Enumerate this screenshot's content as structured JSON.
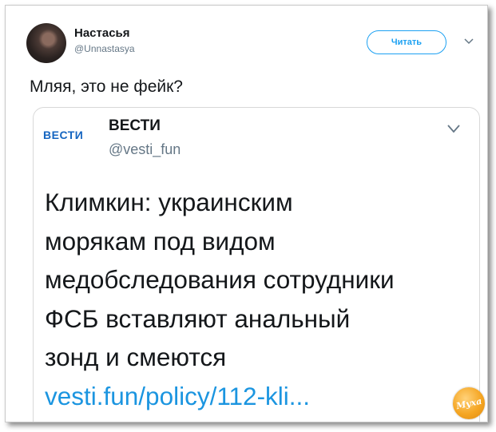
{
  "tweet": {
    "author_name": "Настасья",
    "author_handle": "@Unnastasya",
    "follow_label": "Читать",
    "text": "Мляя, это не фейк?"
  },
  "quoted_tweet": {
    "logo_text": "ВЕСТИ",
    "name": "ВЕСТИ",
    "handle": "@vesti_fun",
    "text_lines": [
      "Климкин: украинским",
      "морякам под видом",
      "медобследования сотрудники",
      "ФСБ вставляют анальный",
      "зонд и смеются"
    ],
    "link": "vesti.fun/policy/112-kli..."
  },
  "watermark": {
    "text": "Муха"
  },
  "colors": {
    "accent": "#1da1f2",
    "link": "#1b95e0",
    "text": "#14171a",
    "muted": "#657786"
  }
}
